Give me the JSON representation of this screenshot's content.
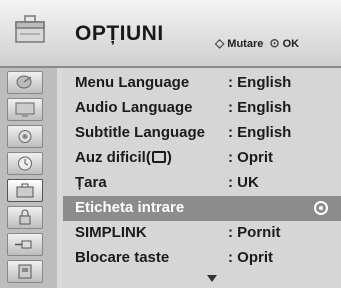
{
  "header": {
    "title": "OPȚIUNI",
    "hint_nav_glyph": "◇",
    "hint_nav_label": "Mutare",
    "hint_ok_glyph": "⊙",
    "hint_ok_label": "OK"
  },
  "sidebar": {
    "items": [
      {
        "icon": "satellite-dish-icon",
        "active": false
      },
      {
        "icon": "picture-monitor-icon",
        "active": false
      },
      {
        "icon": "speaker-audio-icon",
        "active": false
      },
      {
        "icon": "clock-time-icon",
        "active": false
      },
      {
        "icon": "option-toolbox-icon",
        "active": true
      },
      {
        "icon": "lock-icon",
        "active": false
      },
      {
        "icon": "input-plug-icon",
        "active": false
      },
      {
        "icon": "usb-media-icon",
        "active": false
      }
    ]
  },
  "menu": {
    "rows": [
      {
        "label": "Menu Language",
        "value": ": English"
      },
      {
        "label": "Audio Language",
        "value": ": English"
      },
      {
        "label": "Subtitle Language",
        "value": ": English"
      },
      {
        "label_pre": "Auz dificil(",
        "label_post": ")",
        "value": ": Oprit"
      },
      {
        "label": "Țara",
        "value": ": UK"
      },
      {
        "label": "Eticheta intrare",
        "value": "",
        "selected": true
      },
      {
        "label": "SIMPLINK",
        "value": ": Pornit"
      },
      {
        "label": "Blocare taste",
        "value": ": Oprit"
      }
    ]
  },
  "colors": {
    "selected_row": "#8c8c8c",
    "text": "#1b1b1b"
  }
}
